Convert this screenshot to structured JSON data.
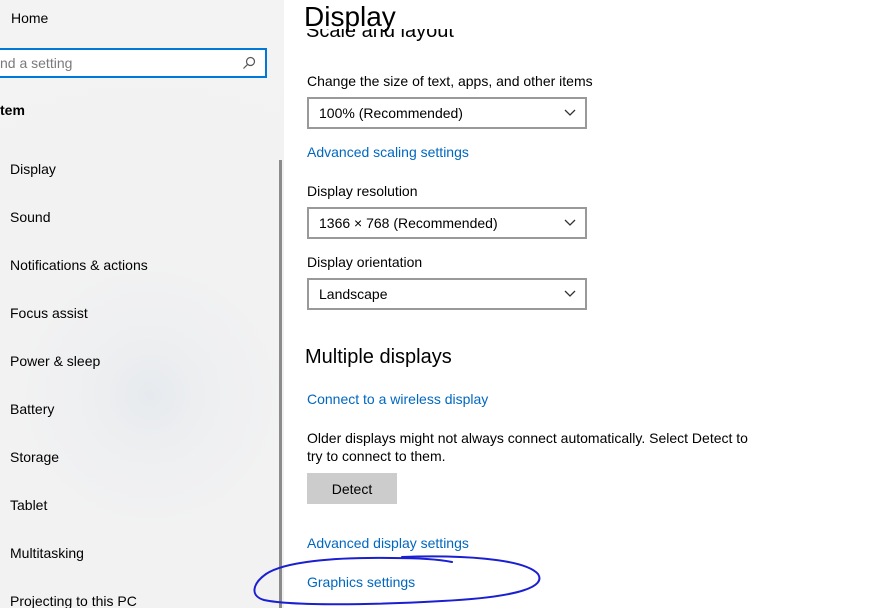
{
  "sidebar": {
    "home_label": "Home",
    "search_placeholder": "nd a setting",
    "section_label": "tem",
    "items": [
      {
        "label": "Display"
      },
      {
        "label": "Sound"
      },
      {
        "label": "Notifications & actions"
      },
      {
        "label": "Focus assist"
      },
      {
        "label": "Power & sleep"
      },
      {
        "label": "Battery"
      },
      {
        "label": "Storage"
      },
      {
        "label": "Tablet"
      },
      {
        "label": "Multitasking"
      },
      {
        "label": "Projecting to this PC"
      }
    ]
  },
  "main": {
    "title": "Display",
    "scale_section_heading": "Scale and layout",
    "scale_label": "Change the size of text, apps, and other items",
    "scale_value": "100% (Recommended)",
    "advanced_scaling_link": "Advanced scaling settings",
    "resolution_label": "Display resolution",
    "resolution_value": "1366 × 768 (Recommended)",
    "orientation_label": "Display orientation",
    "orientation_value": "Landscape",
    "multiple_heading": "Multiple displays",
    "wireless_link": "Connect to a wireless display",
    "detect_description": "Older displays might not always connect automatically. Select Detect to try to connect to them.",
    "detect_button": "Detect",
    "advanced_display_link": "Advanced display settings",
    "graphics_link": "Graphics settings"
  },
  "colors": {
    "accent": "#0078d7",
    "link": "#0067c0",
    "annotation": "#1a1fd1",
    "button_bg": "#cccccc"
  }
}
